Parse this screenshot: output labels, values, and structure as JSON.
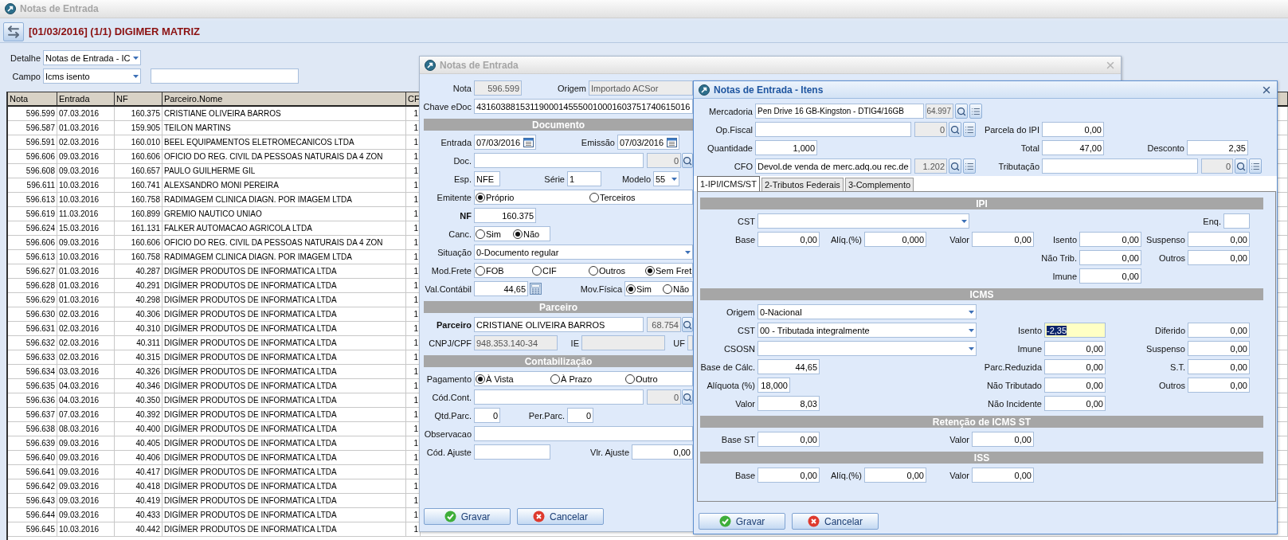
{
  "main_window": {
    "title": "Notas de Entrada",
    "active": false,
    "header": "[01/03/2016] (1/1) DIGIMER MATRIZ",
    "detalhe": {
      "label": "Detalhe",
      "value": "Notas de Entrada - IC"
    },
    "campo": {
      "label": "Campo",
      "value": "Icms isento"
    },
    "table": {
      "columns": [
        "Nota",
        "Entrada",
        "NF",
        "Parceiro.Nome",
        "CF"
      ],
      "rows": [
        [
          "596.599",
          "07.03.2016",
          "160.375",
          "CRISTIANE OLIVEIRA BARROS",
          "1"
        ],
        [
          "596.587",
          "01.03.2016",
          "159.905",
          "TEILON MARTINS",
          "1"
        ],
        [
          "596.591",
          "02.03.2016",
          "160.010",
          "BEEL EQUIPAMENTOS ELETROMECANICOS LTDA",
          "1"
        ],
        [
          "596.606",
          "09.03.2016",
          "160.606",
          "OFICIO DO REG. CIVIL DA PESSOAS NATURAIS DA 4 ZON",
          "1"
        ],
        [
          "596.608",
          "09.03.2016",
          "160.657",
          "PAULO GUILHERME GIL",
          "1"
        ],
        [
          "596.611",
          "10.03.2016",
          "160.741",
          "ALEXSANDRO MONI PEREIRA",
          "1"
        ],
        [
          "596.613",
          "10.03.2016",
          "160.758",
          "RADIMAGEM CLINICA DIAGN. POR IMAGEM LTDA",
          "1"
        ],
        [
          "596.619",
          "11.03.2016",
          "160.899",
          "GREMIO NAUTICO UNIAO",
          "1"
        ],
        [
          "596.624",
          "15.03.2016",
          "161.131",
          "FALKER AUTOMACAO AGRICOLA LTDA",
          "1"
        ],
        [
          "596.606",
          "09.03.2016",
          "160.606",
          "OFICIO DO REG. CIVIL DA PESSOAS NATURAIS DA 4 ZON",
          "1"
        ],
        [
          "596.613",
          "10.03.2016",
          "160.758",
          "RADIMAGEM CLINICA DIAGN. POR IMAGEM LTDA",
          "1"
        ],
        [
          "596.627",
          "01.03.2016",
          "40.287",
          "DIGÍMER PRODUTOS DE INFORMATICA LTDA",
          "1"
        ],
        [
          "596.628",
          "01.03.2016",
          "40.291",
          "DIGÍMER PRODUTOS DE INFORMATICA LTDA",
          "1"
        ],
        [
          "596.629",
          "01.03.2016",
          "40.298",
          "DIGÍMER PRODUTOS DE INFORMATICA LTDA",
          "1"
        ],
        [
          "596.630",
          "02.03.2016",
          "40.306",
          "DIGÍMER PRODUTOS DE INFORMATICA LTDA",
          "1"
        ],
        [
          "596.631",
          "02.03.2016",
          "40.310",
          "DIGÍMER PRODUTOS DE INFORMATICA LTDA",
          "1"
        ],
        [
          "596.632",
          "02.03.2016",
          "40.311",
          "DIGÍMER PRODUTOS DE INFORMATICA LTDA",
          "1"
        ],
        [
          "596.633",
          "02.03.2016",
          "40.315",
          "DIGÍMER PRODUTOS DE INFORMATICA LTDA",
          "1"
        ],
        [
          "596.634",
          "03.03.2016",
          "40.326",
          "DIGÍMER PRODUTOS DE INFORMATICA LTDA",
          "1"
        ],
        [
          "596.635",
          "04.03.2016",
          "40.346",
          "DIGÍMER PRODUTOS DE INFORMATICA LTDA",
          "1"
        ],
        [
          "596.636",
          "04.03.2016",
          "40.350",
          "DIGÍMER PRODUTOS DE INFORMATICA LTDA",
          "1"
        ],
        [
          "596.637",
          "07.03.2016",
          "40.392",
          "DIGÍMER PRODUTOS DE INFORMATICA LTDA",
          "1"
        ],
        [
          "596.638",
          "08.03.2016",
          "40.400",
          "DIGÍMER PRODUTOS DE INFORMATICA LTDA",
          "1"
        ],
        [
          "596.639",
          "09.03.2016",
          "40.405",
          "DIGÍMER PRODUTOS DE INFORMATICA LTDA",
          "1"
        ],
        [
          "596.640",
          "09.03.2016",
          "40.406",
          "DIGÍMER PRODUTOS DE INFORMATICA LTDA",
          "1"
        ],
        [
          "596.641",
          "09.03.2016",
          "40.417",
          "DIGÍMER PRODUTOS DE INFORMATICA LTDA",
          "1"
        ],
        [
          "596.642",
          "09.03.2016",
          "40.418",
          "DIGÍMER PRODUTOS DE INFORMATICA LTDA",
          "1"
        ],
        [
          "596.643",
          "09.03.2016",
          "40.419",
          "DIGÍMER PRODUTOS DE INFORMATICA LTDA",
          "1"
        ],
        [
          "596.644",
          "09.03.2016",
          "40.433",
          "DIGÍMER PRODUTOS DE INFORMATICA LTDA",
          "1"
        ],
        [
          "596.645",
          "10.03.2016",
          "40.442",
          "DIGÍMER PRODUTOS DE INFORMATICA LTDA",
          "1"
        ]
      ]
    }
  },
  "entry_dialog": {
    "title": "Notas de Entrada",
    "active": false,
    "nota": {
      "label": "Nota",
      "value": "596.599"
    },
    "origem": {
      "label": "Origem",
      "value": "Importado ACSor"
    },
    "chave": {
      "label": "Chave eDoc",
      "value": "43160388153119000145550010001603751740615016"
    },
    "documento": {
      "title": "Documento",
      "entrada": {
        "label": "Entrada",
        "value": "07/03/2016"
      },
      "emissao": {
        "label": "Emissão",
        "value": "07/03/2016"
      },
      "doc": {
        "label": "Doc.",
        "code": "0"
      },
      "esp": {
        "label": "Esp.",
        "value": "NFE"
      },
      "serie": {
        "label": "Série",
        "value": "1"
      },
      "modelo": {
        "label": "Modelo",
        "value": "55"
      },
      "emitente": {
        "label": "Emitente",
        "options": [
          {
            "label": "Próprio",
            "selected": true
          },
          {
            "label": "Terceiros",
            "selected": false
          }
        ]
      },
      "nf": {
        "label": "NF",
        "value": "160.375"
      },
      "canc": {
        "label": "Canc.",
        "options": [
          {
            "label": "Sim",
            "selected": false
          },
          {
            "label": "Não",
            "selected": true
          }
        ]
      },
      "situacao": {
        "label": "Situação",
        "value": "0-Documento regular"
      },
      "mod_frete": {
        "label": "Mod.Frete",
        "options": [
          {
            "label": "FOB",
            "selected": false
          },
          {
            "label": "CIF",
            "selected": false
          },
          {
            "label": "Outros",
            "selected": false
          },
          {
            "label": "Sem Fret",
            "selected": true
          }
        ]
      },
      "val_contabil": {
        "label": "Val.Contábil",
        "value": "44,65"
      },
      "mov_fisica": {
        "label": "Mov.Física",
        "options": [
          {
            "label": "Sim",
            "selected": true
          },
          {
            "label": "Não",
            "selected": false
          }
        ]
      }
    },
    "parceiro": {
      "title": "Parceiro",
      "parceiro": {
        "label": "Parceiro",
        "value": "CRISTIANE OLIVEIRA BARROS",
        "code": "68.754"
      },
      "cnpj": {
        "label": "CNPJ/CPF",
        "value": "948.353.140-34"
      },
      "ie": {
        "label": "IE"
      },
      "uf": {
        "label": "UF"
      }
    },
    "contabilizacao": {
      "title": "Contabilização",
      "pagamento": {
        "label": "Pagamento",
        "options": [
          {
            "label": "À Vista",
            "selected": true
          },
          {
            "label": "À Prazo",
            "selected": false
          },
          {
            "label": "Outro",
            "selected": false
          }
        ]
      },
      "cod_cont": {
        "label": "Cód.Cont.",
        "code": "0"
      },
      "qtd_parc": {
        "label": "Qtd.Parc.",
        "value": "0"
      },
      "per_parc": {
        "label": "Per.Parc.",
        "value": "0"
      },
      "observacao": {
        "label": "Observacao"
      },
      "cod_ajuste": {
        "label": "Cód. Ajuste"
      },
      "vlr_ajuste": {
        "label": "Vlr. Ajuste",
        "value": "0,00"
      }
    },
    "buttons": [
      {
        "label": "Gravar",
        "kind": "save"
      },
      {
        "label": "Cancelar",
        "kind": "cancel"
      }
    ]
  },
  "item_dialog": {
    "title": "Notas de Entrada - Itens",
    "active": true,
    "mercadoria": {
      "label": "Mercadoria",
      "value": "Pen Drive 16 GB-Kingston - DTIG4/16GB",
      "code": "64.997"
    },
    "op_fiscal": {
      "label": "Op.Fiscal",
      "code": "0"
    },
    "parcela_ipi": {
      "label": "Parcela do IPI",
      "value": "0,00"
    },
    "quantidade": {
      "label": "Quantidade",
      "value": "1,000"
    },
    "total": {
      "label": "Total",
      "value": "47,00"
    },
    "desconto": {
      "label": "Desconto",
      "value": "2,35"
    },
    "cfo": {
      "label": "CFO",
      "value": "Devol.de venda de merc.adq.ou rec.de",
      "code": "1.202"
    },
    "tributacao": {
      "label": "Tributação",
      "code": "0"
    },
    "tabs": [
      {
        "label": "1-IPI/ICMS/ST",
        "selected": true
      },
      {
        "label": "2-Tributos Federais",
        "selected": false
      },
      {
        "label": "3-Complemento",
        "selected": false
      }
    ],
    "ipi": {
      "title": "IPI",
      "cst": {
        "label": "CST"
      },
      "enq": {
        "label": "Enq."
      },
      "base": {
        "label": "Base",
        "value": "0,00"
      },
      "aliq": {
        "label": "Alíq.(%)",
        "value": "0,000"
      },
      "valor": {
        "label": "Valor",
        "value": "0,00"
      },
      "isento": {
        "label": "Isento",
        "value": "0,00"
      },
      "suspenso": {
        "label": "Suspenso",
        "value": "0,00"
      },
      "nao_trib": {
        "label": "Não Trib.",
        "value": "0,00"
      },
      "outros": {
        "label": "Outros",
        "value": "0,00"
      },
      "imune": {
        "label": "Imune",
        "value": "0,00"
      }
    },
    "icms": {
      "title": "ICMS",
      "origem": {
        "label": "Origem",
        "value": "0-Nacional"
      },
      "cst": {
        "label": "CST",
        "value": "00 - Tributada integralmente"
      },
      "isento": {
        "label": "Isento",
        "value": "-2,35",
        "focused": true
      },
      "diferido": {
        "label": "Diferido",
        "value": "0,00"
      },
      "csosn": {
        "label": "CSOSN"
      },
      "imune": {
        "label": "Imune",
        "value": "0,00"
      },
      "suspenso": {
        "label": "Suspenso",
        "value": "0,00"
      },
      "base_calc": {
        "label": "Base de Cálc.",
        "value": "44,65"
      },
      "parc_reduzida": {
        "label": "Parc.Reduzida",
        "value": "0,00"
      },
      "st": {
        "label": "S.T.",
        "value": "0,00"
      },
      "aliquota": {
        "label": "Alíquota (%)",
        "value": "18,000"
      },
      "nao_tributado": {
        "label": "Não Tributado",
        "value": "0,00"
      },
      "outros": {
        "label": "Outros",
        "value": "0,00"
      },
      "valor": {
        "label": "Valor",
        "value": "8,03"
      },
      "nao_incidente": {
        "label": "Não Incidente",
        "value": "0,00"
      }
    },
    "retencao": {
      "title": "Retenção de ICMS ST",
      "base_st": {
        "label": "Base ST",
        "value": "0,00"
      },
      "valor": {
        "label": "Valor",
        "value": "0,00"
      }
    },
    "iss": {
      "title": "ISS",
      "base": {
        "label": "Base",
        "value": "0,00"
      },
      "aliq": {
        "label": "Alíq.(%)",
        "value": "0,00"
      },
      "valor": {
        "label": "Valor",
        "value": "0,00"
      }
    },
    "buttons": [
      {
        "label": "Gravar",
        "kind": "save"
      },
      {
        "label": "Cancelar",
        "kind": "cancel"
      }
    ]
  }
}
